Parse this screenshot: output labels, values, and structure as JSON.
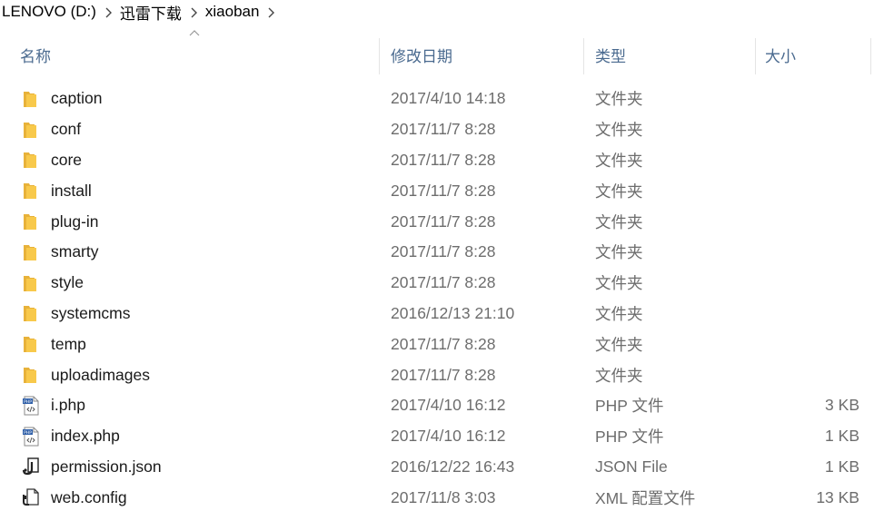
{
  "breadcrumb": [
    "LENOVO (D:)",
    "迅雷下载",
    "xiaoban"
  ],
  "columns": {
    "name": "名称",
    "date": "修改日期",
    "type": "类型",
    "size": "大小"
  },
  "files": [
    {
      "name": "caption",
      "date": "2017/4/10 14:18",
      "type": "文件夹",
      "size": "",
      "icon": "folder-icon"
    },
    {
      "name": "conf",
      "date": "2017/11/7 8:28",
      "type": "文件夹",
      "size": "",
      "icon": "folder-icon"
    },
    {
      "name": "core",
      "date": "2017/11/7 8:28",
      "type": "文件夹",
      "size": "",
      "icon": "folder-icon"
    },
    {
      "name": "install",
      "date": "2017/11/7 8:28",
      "type": "文件夹",
      "size": "",
      "icon": "folder-icon"
    },
    {
      "name": "plug-in",
      "date": "2017/11/7 8:28",
      "type": "文件夹",
      "size": "",
      "icon": "folder-icon"
    },
    {
      "name": "smarty",
      "date": "2017/11/7 8:28",
      "type": "文件夹",
      "size": "",
      "icon": "folder-icon"
    },
    {
      "name": "style",
      "date": "2017/11/7 8:28",
      "type": "文件夹",
      "size": "",
      "icon": "folder-icon"
    },
    {
      "name": "systemcms",
      "date": "2016/12/13 21:10",
      "type": "文件夹",
      "size": "",
      "icon": "folder-icon"
    },
    {
      "name": "temp",
      "date": "2017/11/7 8:28",
      "type": "文件夹",
      "size": "",
      "icon": "folder-icon"
    },
    {
      "name": "uploadimages",
      "date": "2017/11/7 8:28",
      "type": "文件夹",
      "size": "",
      "icon": "folder-icon"
    },
    {
      "name": "i.php",
      "date": "2017/4/10 16:12",
      "type": "PHP 文件",
      "size": "3 KB",
      "icon": "php-file-icon"
    },
    {
      "name": "index.php",
      "date": "2017/4/10 16:12",
      "type": "PHP 文件",
      "size": "1 KB",
      "icon": "php-file-icon"
    },
    {
      "name": "permission.json",
      "date": "2016/12/22 16:43",
      "type": "JSON File",
      "size": "1 KB",
      "icon": "json-file-icon"
    },
    {
      "name": "web.config",
      "date": "2017/11/8 3:03",
      "type": "XML 配置文件",
      "size": "13 KB",
      "icon": "config-file-icon"
    }
  ],
  "colors": {
    "header_text": "#4a6a8f",
    "folder": "#f8c94b",
    "secondary_text": "#6d6d6d"
  }
}
